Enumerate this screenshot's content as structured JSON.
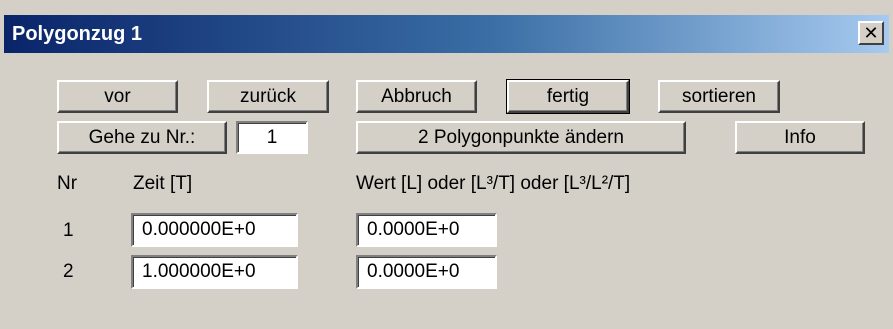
{
  "window": {
    "title": "Polygonzug 1",
    "close_glyph": "✕"
  },
  "toolbar": {
    "vor_label": "vor",
    "zurueck_label": "zurück",
    "abbruch_label": "Abbruch",
    "fertig_label": "fertig",
    "sortieren_label": "sortieren",
    "goto_label": "Gehe zu Nr.:",
    "goto_value": "1",
    "change_points_label": "2 Polygonpunkte ändern",
    "info_label": "Info"
  },
  "table": {
    "headers": {
      "nr": "Nr",
      "zeit": "Zeit [T]",
      "wert": "Wert [L] oder [L³/T] oder [L³/L²/T]"
    },
    "rows": [
      {
        "nr": "1",
        "zeit": "0.000000E+0",
        "wert": "0.0000E+0"
      },
      {
        "nr": "2",
        "zeit": "1.000000E+0",
        "wert": "0.0000E+0"
      }
    ]
  }
}
